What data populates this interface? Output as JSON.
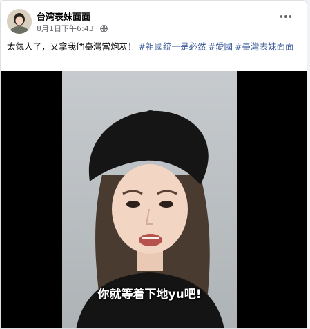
{
  "post": {
    "author": "台湾表妹面面",
    "timestamp": "8月1日下午6:43",
    "separator": "·",
    "caption_text": "太氣人了，又拿我們臺灣當炮灰！",
    "hashtags": [
      "#祖國統一是必然",
      "#愛國",
      "#臺灣表妹面面"
    ],
    "privacy_icon": "globe-icon",
    "more_icon": "more-options-icon"
  },
  "video": {
    "subtitle": "你就等着下地yu吧!"
  },
  "colors": {
    "hashtag": "#385898",
    "meta": "#65676b",
    "video_bg": "#000000"
  }
}
